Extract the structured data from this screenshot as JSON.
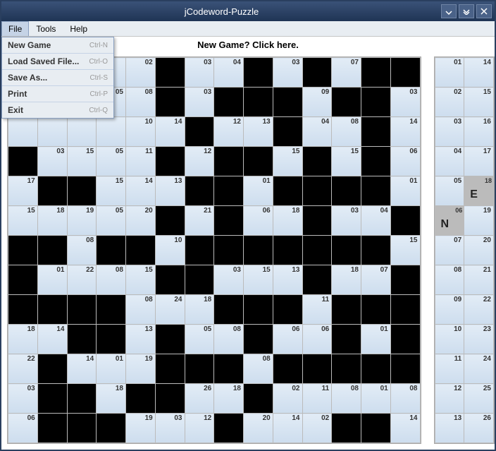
{
  "window": {
    "title": "jCodeword-Puzzle"
  },
  "menubar": [
    "File",
    "Tools",
    "Help"
  ],
  "filemenu": [
    {
      "label": "New Game",
      "shortcut": "Ctrl-N"
    },
    {
      "label": "Load Saved File...",
      "shortcut": "Ctrl-O"
    },
    {
      "label": "Save As...",
      "shortcut": "Ctrl-S"
    },
    {
      "label": "Print",
      "shortcut": "Ctrl-P"
    },
    {
      "label": "Exit",
      "shortcut": "Ctrl-Q"
    }
  ],
  "newgame_banner": "New Game? Click here.",
  "grid": [
    [
      null,
      null,
      null,
      null,
      "02",
      "",
      "03",
      "04",
      "",
      "03",
      "",
      "07",
      "",
      ""
    ],
    [
      null,
      null,
      null,
      "05",
      "08",
      "",
      "03",
      "",
      "",
      "",
      "09",
      "",
      "",
      "03"
    ],
    [
      null,
      null,
      null,
      null,
      "10",
      "14",
      "",
      "12",
      "13",
      "",
      "04",
      "08",
      "",
      "14"
    ],
    [
      "",
      "03",
      "15",
      "05",
      "11",
      "",
      "12",
      "",
      "",
      "15",
      "",
      "15",
      "",
      "06"
    ],
    [
      "17",
      "",
      "",
      "15",
      "14",
      "13",
      "",
      "",
      "01",
      "",
      "",
      "",
      "",
      "01"
    ],
    [
      "15",
      "18",
      "19",
      "05",
      "20",
      "",
      "21",
      "",
      "06",
      "18",
      "",
      "03",
      "04",
      ""
    ],
    [
      "",
      "",
      "08",
      "",
      "",
      "10",
      "",
      "",
      "",
      "",
      "",
      "",
      "",
      "15"
    ],
    [
      "",
      "01",
      "22",
      "08",
      "15",
      "",
      "",
      "03",
      "15",
      "13",
      "",
      "18",
      "07",
      ""
    ],
    [
      "",
      "",
      "",
      "",
      "08",
      "24",
      "18",
      "",
      "",
      "",
      "11",
      "",
      "",
      ""
    ],
    [
      "18",
      "14",
      "",
      "",
      "13",
      "",
      "05",
      "08",
      "",
      "06",
      "06",
      "",
      "01",
      ""
    ],
    [
      "22",
      "",
      "14",
      "01",
      "19",
      "",
      "",
      "",
      "08",
      "",
      "",
      "",
      "",
      ""
    ],
    [
      "03",
      "",
      "",
      "18",
      "",
      "",
      "26",
      "18",
      "",
      "02",
      "11",
      "08",
      "01",
      "08"
    ],
    [
      "06",
      "",
      "",
      "",
      "19",
      "03",
      "12",
      "",
      "20",
      "14",
      "02",
      "",
      "",
      "14"
    ]
  ],
  "side": [
    [
      "01",
      "14"
    ],
    [
      "02",
      "15"
    ],
    [
      "03",
      "16"
    ],
    [
      "04",
      "17"
    ],
    [
      "05",
      {
        "num": "18",
        "let": "E"
      }
    ],
    [
      {
        "num": "06",
        "let": "N"
      },
      "19"
    ],
    [
      "07",
      "20"
    ],
    [
      "08",
      "21"
    ],
    [
      "09",
      "22"
    ],
    [
      "10",
      "23"
    ],
    [
      "11",
      "24"
    ],
    [
      "12",
      "25"
    ],
    [
      "13",
      "26"
    ]
  ]
}
